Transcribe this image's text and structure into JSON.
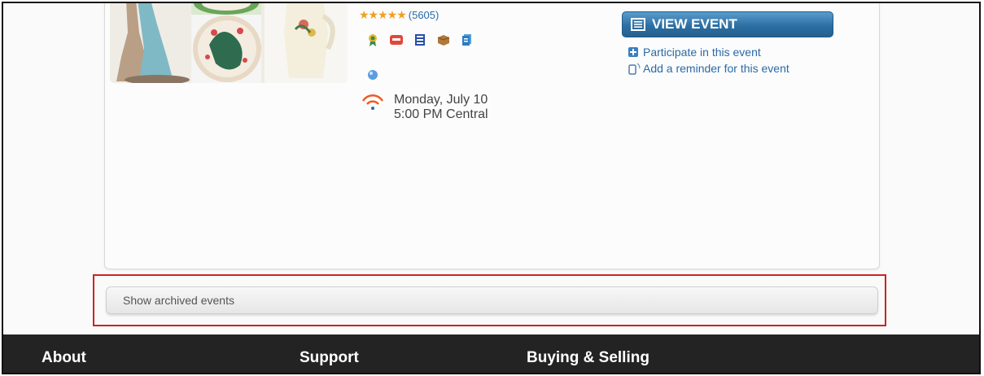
{
  "event": {
    "rating_count": "(5605)",
    "date": "Monday, July 10",
    "time": "5:00 PM Central",
    "view_button": "VIEW EVENT",
    "participate_link": "Participate in this event",
    "reminder_link": "Add a reminder for this event",
    "stars": 5
  },
  "archived": {
    "label": "Show archived events"
  },
  "footer": {
    "col1": "About",
    "col2": "Support",
    "col3": "Buying & Selling"
  },
  "colors": {
    "accent_blue": "#2d6fa3",
    "link_blue": "#2a6aa8",
    "star": "#f0a020",
    "footer_bg": "#232323",
    "highlight_border": "#cc2222"
  }
}
